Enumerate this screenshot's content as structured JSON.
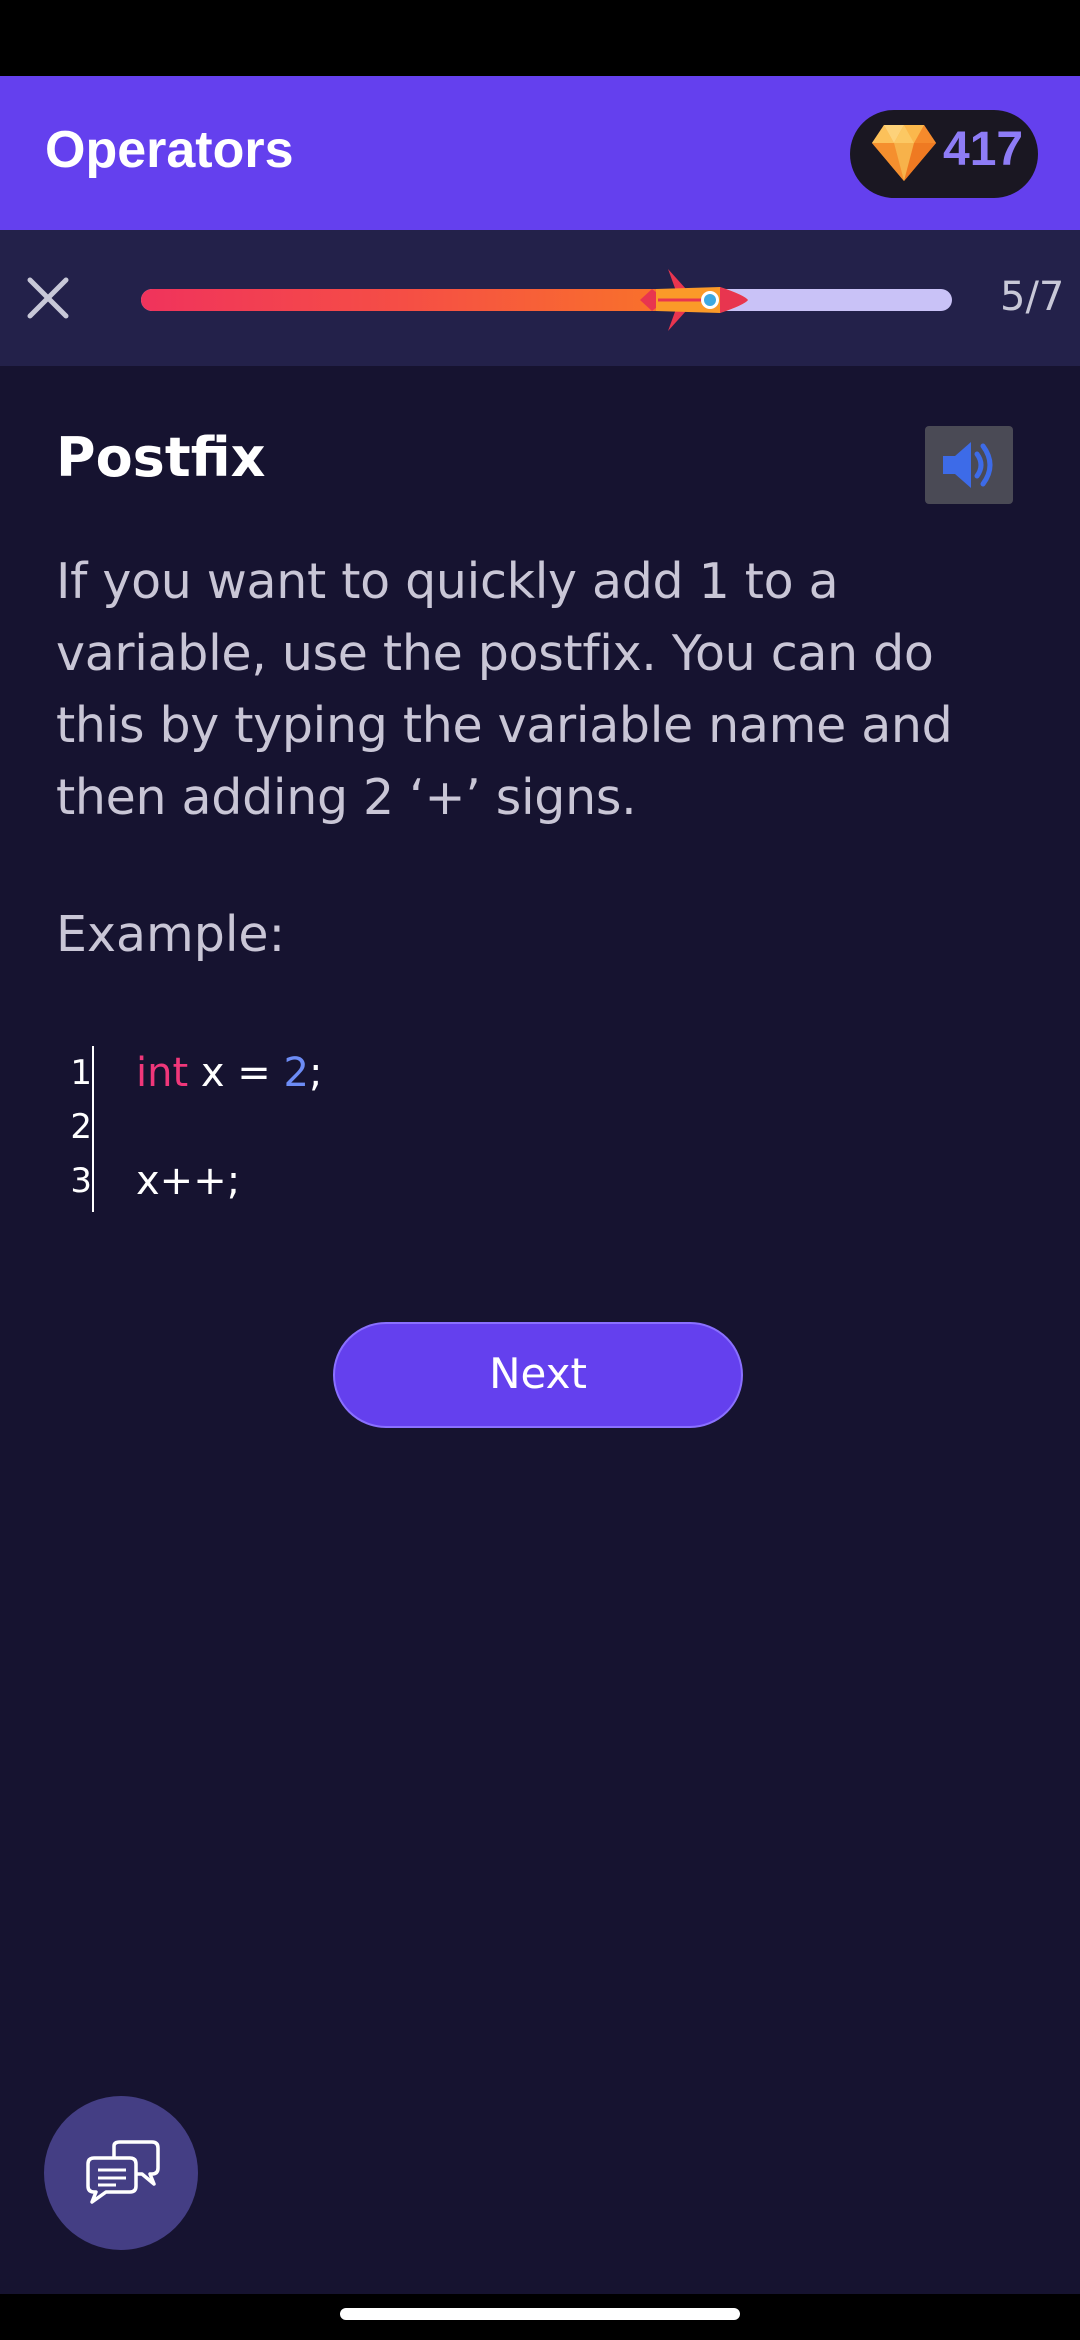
{
  "header": {
    "title": "Operators",
    "gem_count": "417",
    "gem_icon": "diamond-icon"
  },
  "progress": {
    "text": "5/7",
    "value": 0.72,
    "close_icon": "close-icon",
    "rocket_icon": "rocket-icon"
  },
  "lesson": {
    "title": "Postfix",
    "audio_icon": "speaker-icon",
    "paragraph": "If you want to quickly add 1 to a variable, use the postfix. You can do this by typing the variable name and then adding 2 ‘+’ signs.",
    "example_label": "Example:",
    "code": {
      "line_numbers": [
        "1",
        "2",
        "3"
      ],
      "line1_keyword": "int",
      "line1_mid": " x = ",
      "line1_number": "2",
      "line1_end": ";",
      "line2": "",
      "line3": "x++;"
    },
    "next_label": "Next"
  },
  "fab": {
    "icon": "chat-bubbles-icon"
  },
  "colors": {
    "primary": "#6440EE",
    "background": "#161330",
    "progress_bar_bg": "#23214A",
    "keyword": "#F0377A",
    "number": "#6D8CF5"
  }
}
